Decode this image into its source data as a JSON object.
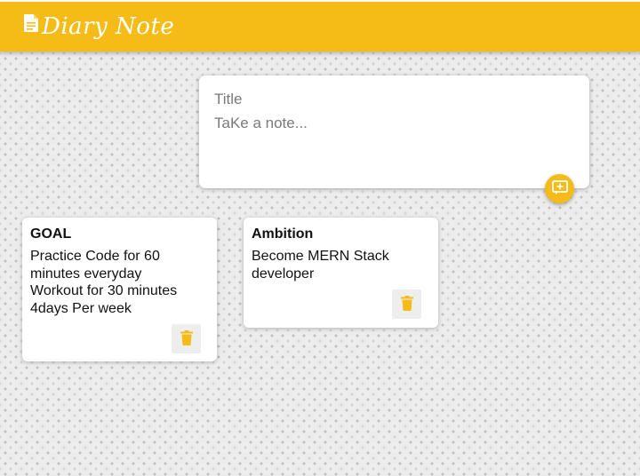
{
  "header": {
    "title": "Diary Note",
    "icon": "note-icon",
    "color": "#f5bb16"
  },
  "composer": {
    "title_placeholder": "Title",
    "note_placeholder": "TaKe a note...",
    "add_icon": "add-note-icon"
  },
  "notes": [
    {
      "title": "GOAL",
      "body": "Practice Code for 60\nminutes everyday\nWorkout for 30 minutes\n4days Per week",
      "delete_icon": "trash-icon"
    },
    {
      "title": "Ambition",
      "body": "Become MERN Stack\ndeveloper",
      "delete_icon": "trash-icon"
    }
  ]
}
